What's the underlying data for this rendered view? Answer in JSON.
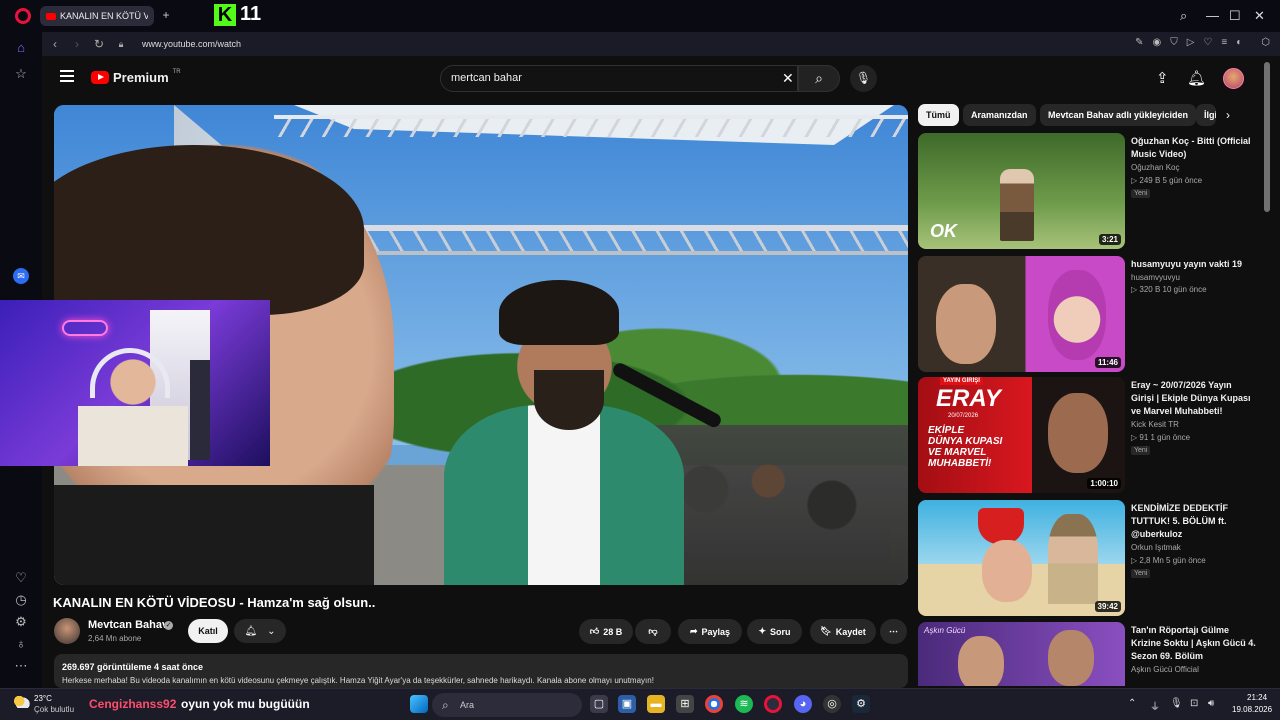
{
  "browser": {
    "tab_title": "KANALIN EN KÖTÜ VİDEO",
    "kick_number": "11",
    "url": "www.youtube.com/watch"
  },
  "youtube": {
    "logo_text": "Premium",
    "region": "TR",
    "search_value": "mertcan bahar"
  },
  "video": {
    "title": "KANALIN EN KÖTÜ VİDEOSU - Hamza'm sağ olsun..",
    "channel": "Mevtcan Bahav",
    "subscribers": "2,64 Mn abone",
    "join_label": "Katıl",
    "likes": "28 B",
    "share_label": "Paylaş",
    "ask_label": "Soru",
    "save_label": "Kaydet",
    "views_line": "269.697 görüntüleme   4 saat önce",
    "description": "Herkese merhaba! Bu videoda kanalımın en kötü videosunu çekmeye çalıştık. Hamza Yiğit Ayar'ya da teşekkürler, sahnede harikaydı. Kanala abone olmayı unutmayın!"
  },
  "filters": [
    "Tümü",
    "Aramanızdan",
    "Mevtcan Bahav adlı yükleyiciden",
    "İlgili"
  ],
  "recommended": [
    {
      "title": "Oğuzhan Koç  - Bitti (Official Music Video)",
      "channel": "Oğuzhan Koç",
      "meta": "▷ 249 B   5 gün önce",
      "badge": "Yeni",
      "duration": "3:21"
    },
    {
      "title": "husamyuyu yayın vakti 19",
      "channel": "husamvyuvyu",
      "meta": "▷ 320 B   10 gün önce",
      "badge": "",
      "duration": "11:46"
    },
    {
      "title": "Eray ~ 20/07/2026 Yayın Girişi | Ekiple Dünya Kupası ve Marvel Muhabbeti!",
      "channel": "Kick Kesit TR",
      "meta": "▷ 91   1 gün önce",
      "badge": "Yeni",
      "duration": "1:00:10"
    },
    {
      "title": "KENDİMİZE DEDEKTİF TUTTUK! 5. BÖLÜM ft. @uberkuloz",
      "channel": "Orkun Işıtmak",
      "meta": "▷ 2,8 Mn   5 gün önce",
      "badge": "Yeni",
      "duration": "39:42"
    },
    {
      "title": "Tan'ın Röportajı Gülme Krizine Soktu | Aşkın Gücü 4. Sezon 69. Bölüm",
      "channel": "Aşkın Gücü Official",
      "meta": "",
      "badge": "",
      "duration": ""
    }
  ],
  "thumb_text": {
    "eray_top": "YAYIN GİRİŞİ",
    "eray_name": "ERAY",
    "eray_date": "20/07/2026",
    "eray_line1": "EKİPLE",
    "eray_line2": "DÜNYA KUPASI",
    "eray_line3": "VE MARVEL",
    "eray_line4": "MUHABBETİ!",
    "askin": "Aşkın Gücü"
  },
  "taskbar": {
    "temp": "23°C",
    "weather": "Çok bulutlu",
    "chat_user": "Cengizhanss92",
    "chat_message": "oyun yok mu bugüüün",
    "search_placeholder": "Ara",
    "time": "21:24",
    "date": "19.08.2026"
  },
  "colors": {
    "yt_red": "#ff0000",
    "kick_green": "#53fc18",
    "chat_user": "#ff4d6d"
  }
}
